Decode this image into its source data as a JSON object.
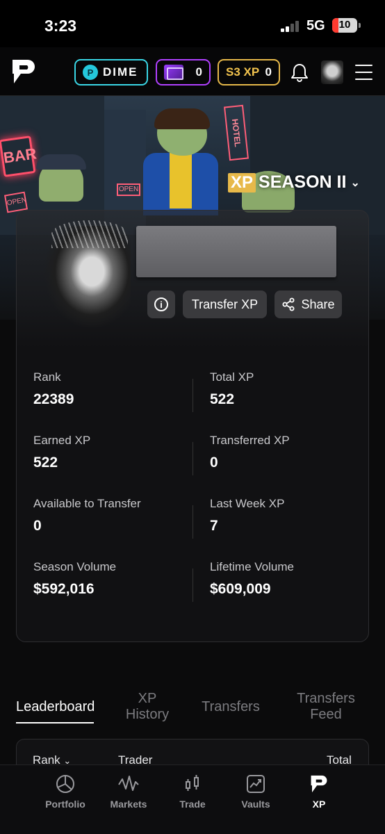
{
  "status": {
    "time": "3:23",
    "network": "5G",
    "battery": "10"
  },
  "nav": {
    "dime_label": "DIME",
    "box_count": "0",
    "xp_label": "S3 XP",
    "xp_count": "0"
  },
  "banner": {
    "signs": {
      "bar": "BAR",
      "open1": "OPEN",
      "open2": "OPEN",
      "hotel": "HOTEL"
    },
    "season_xp": "XP",
    "season_text": "SEASON II"
  },
  "profile": {
    "transfer_label": "Transfer XP",
    "share_label": "Share"
  },
  "stats": [
    {
      "left_label": "Rank",
      "left_value": "22389",
      "right_label": "Total XP",
      "right_value": "522"
    },
    {
      "left_label": "Earned XP",
      "left_value": "522",
      "right_label": "Transferred XP",
      "right_value": "0"
    },
    {
      "left_label": "Available to Transfer",
      "left_value": "0",
      "right_label": "Last Week XP",
      "right_value": "7"
    },
    {
      "left_label": "Season Volume",
      "left_value": "$592,016",
      "right_label": "Lifetime Volume",
      "right_value": "$609,009"
    }
  ],
  "tabs": {
    "leaderboard": "Leaderboard",
    "xp_history_1": "XP",
    "xp_history_2": "History",
    "transfers": "Transfers",
    "transfers_feed_1": "Transfers",
    "transfers_feed_2": "Feed"
  },
  "leaderboard": {
    "col_rank": "Rank",
    "col_trader": "Trader",
    "col_total": "Total Sh"
  },
  "bottom_nav": {
    "portfolio": "Portfolio",
    "markets": "Markets",
    "trade": "Trade",
    "vaults": "Vaults",
    "xp": "XP"
  },
  "colors": {
    "dime_accent": "#3ad7e6",
    "box_accent": "#b040ff",
    "xp_accent": "#e6b84a",
    "battery_low": "#ff3b30"
  }
}
